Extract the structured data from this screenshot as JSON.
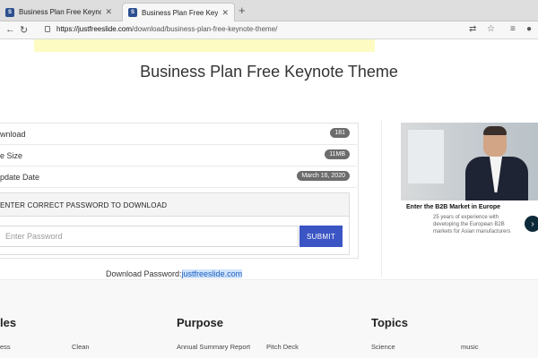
{
  "browser": {
    "tabs": [
      {
        "title": "Business Plan Free Keynote Th",
        "favicon": "S"
      },
      {
        "title": "Business Plan Free Keynote Th",
        "favicon": "S"
      }
    ],
    "new_tab": "+",
    "close": "✕",
    "url_domain": "https://justfreeslide.com",
    "url_path": "/download/business-plan-free-keynote-theme/"
  },
  "page": {
    "title": "Business Plan Free Keynote Theme",
    "rows": [
      {
        "label": "wnload",
        "badge": "181"
      },
      {
        "label": "e Size",
        "badge": "11MB"
      },
      {
        "label": "pdate Date",
        "badge": "March 16, 2020"
      }
    ],
    "password_heading": "ENTER CORRECT PASSWORD TO DOWNLOAD",
    "password_placeholder": "Enter Password",
    "submit_label": "SUBMIT",
    "download_password_label": "Download Password:",
    "download_password_value": "justfreeslide.com"
  },
  "ad": {
    "title": "Enter the B2B Market in Europe",
    "text": "25 years of experience with developing the European B2B markets for Asian manufacturers",
    "next": "›"
  },
  "footer": {
    "headings": [
      "les",
      "Purpose",
      "Topics"
    ],
    "links": [
      "ess",
      "Clean",
      "Annual Summary Report",
      "Pitch Deck",
      "Science",
      "music"
    ]
  }
}
